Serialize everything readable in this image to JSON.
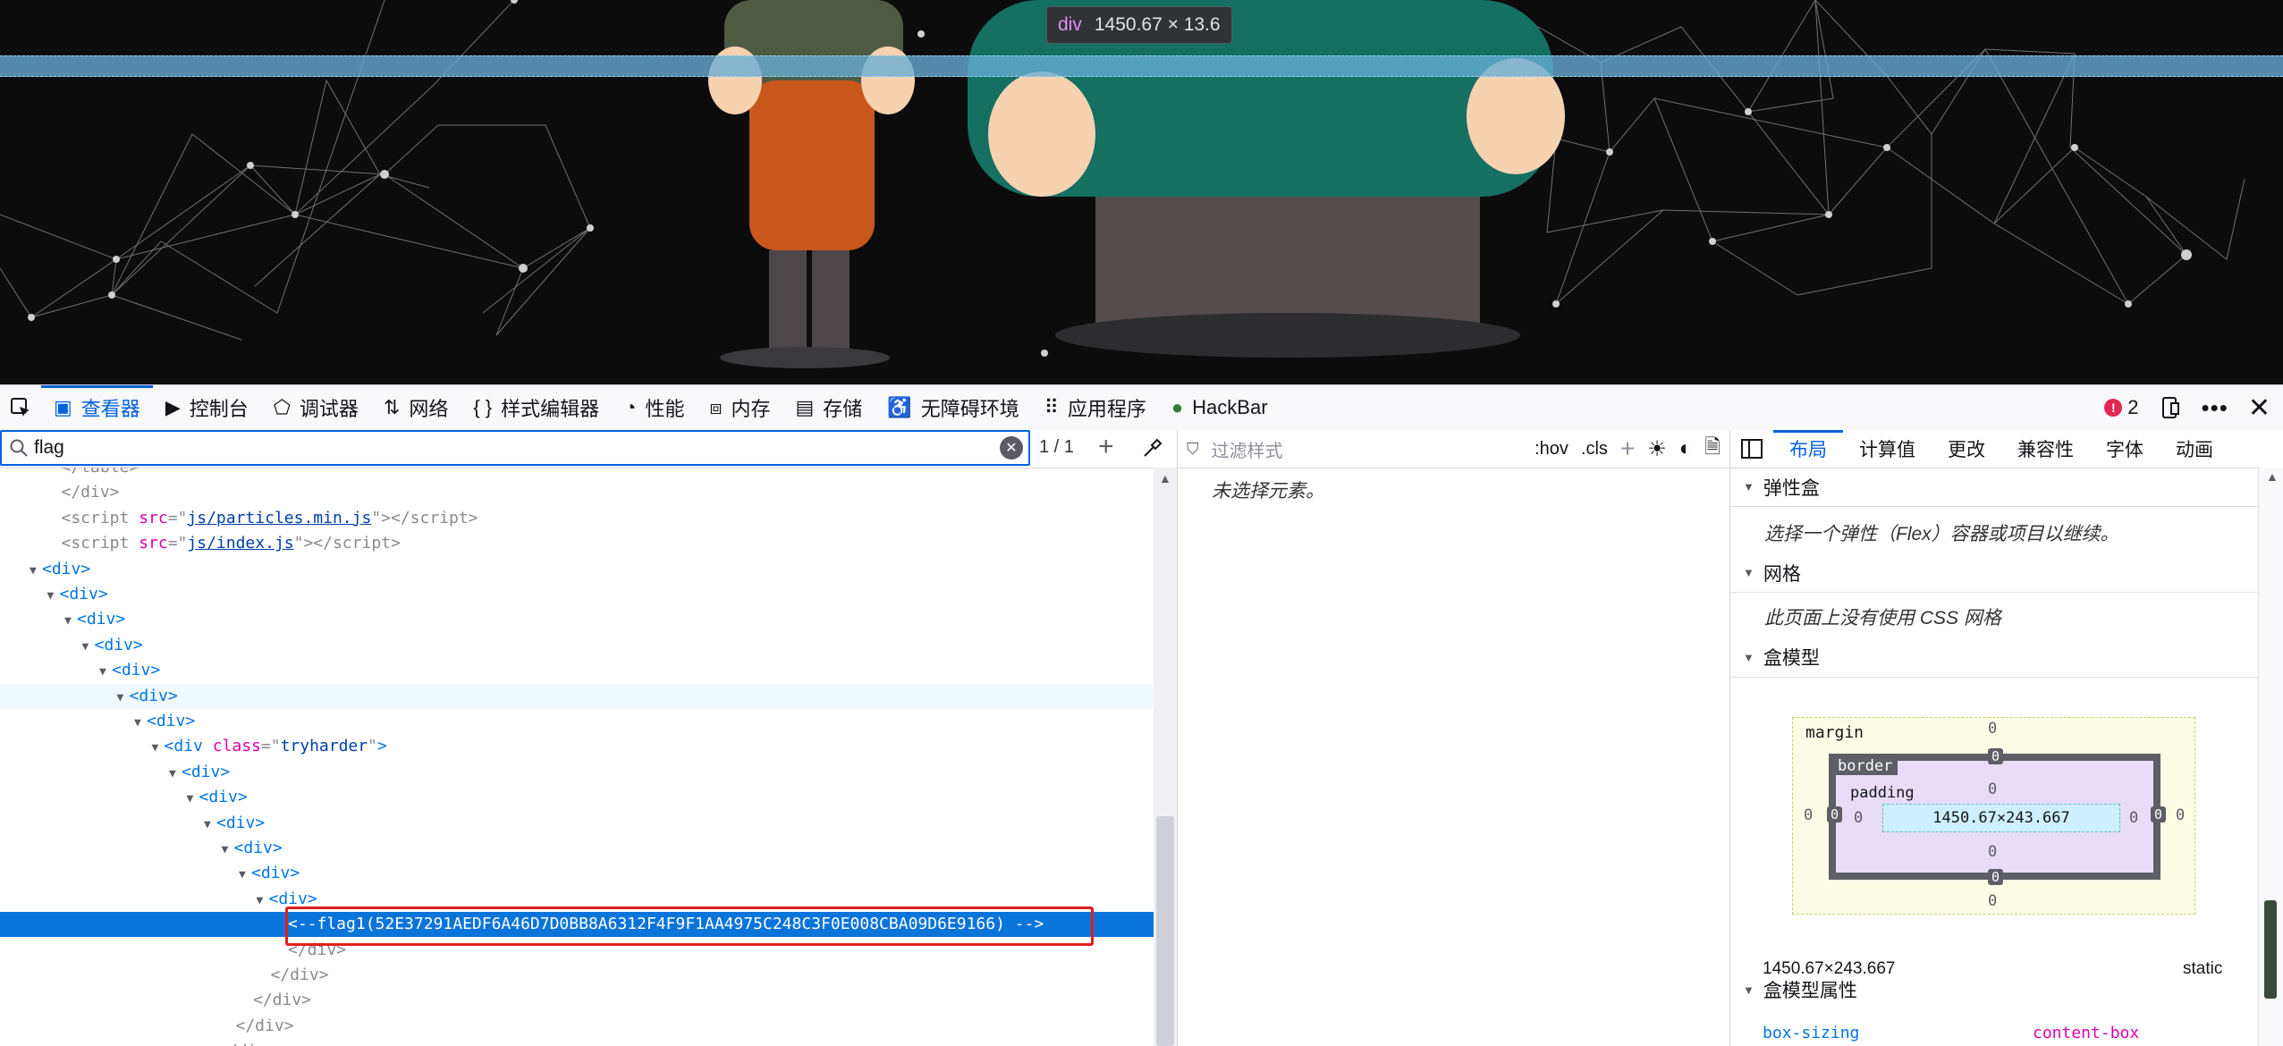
{
  "viewport": {
    "highlight_tag": "div",
    "highlight_dimensions": "1450.67 × 13.6"
  },
  "toolbar": {
    "tabs": [
      {
        "label": "查看器",
        "icon": "inspector-icon"
      },
      {
        "label": "控制台",
        "icon": "console-icon"
      },
      {
        "label": "调试器",
        "icon": "debugger-icon"
      },
      {
        "label": "网络",
        "icon": "network-icon"
      },
      {
        "label": "样式编辑器",
        "icon": "style-editor-icon"
      },
      {
        "label": "性能",
        "icon": "performance-icon"
      },
      {
        "label": "内存",
        "icon": "memory-icon"
      },
      {
        "label": "存储",
        "icon": "storage-icon"
      },
      {
        "label": "无障碍环境",
        "icon": "accessibility-icon"
      },
      {
        "label": "应用程序",
        "icon": "application-icon"
      },
      {
        "label": "HackBar",
        "icon": "hackbar-icon"
      }
    ],
    "error_count": "2",
    "accent": "#0061e0"
  },
  "inspector": {
    "search_value": "flag",
    "search_count": "1 / 1",
    "lines": [
      {
        "indent": 3,
        "text": "</table>",
        "kind": "close"
      },
      {
        "indent": 3,
        "text": "</div>",
        "kind": "close"
      },
      {
        "indent": 3,
        "kind": "script",
        "src": "js/particles.min.js"
      },
      {
        "indent": 3,
        "kind": "script",
        "src": "js/index.js"
      },
      {
        "indent": 2,
        "text": "<div>",
        "kind": "open",
        "twisty": true
      },
      {
        "indent": 3,
        "text": "<div>",
        "kind": "open",
        "twisty": true
      },
      {
        "indent": 4,
        "text": "<div>",
        "kind": "open",
        "twisty": true
      },
      {
        "indent": 5,
        "text": "<div>",
        "kind": "open",
        "twisty": true
      },
      {
        "indent": 6,
        "text": "<div>",
        "kind": "open",
        "twisty": true
      },
      {
        "indent": 7,
        "text": "<div>",
        "kind": "open",
        "twisty": true,
        "hover": true
      },
      {
        "indent": 8,
        "text": "<div>",
        "kind": "open",
        "twisty": true
      },
      {
        "indent": 9,
        "kind": "classdiv",
        "cls": "tryharder",
        "twisty": true
      },
      {
        "indent": 10,
        "text": "<div>",
        "kind": "open",
        "twisty": true
      },
      {
        "indent": 11,
        "text": "<div>",
        "kind": "open",
        "twisty": true
      },
      {
        "indent": 12,
        "text": "<div>",
        "kind": "open",
        "twisty": true
      },
      {
        "indent": 13,
        "text": "<div>",
        "kind": "open",
        "twisty": true
      },
      {
        "indent": 14,
        "text": "<div>",
        "kind": "open",
        "twisty": true
      },
      {
        "indent": 15,
        "text": "<div>",
        "kind": "open",
        "twisty": true
      },
      {
        "indent": 16,
        "text": "<--flag1(52E37291AEDF6A46D7D0BB8A6312F4F9F1AA4975C248C3F0E008CBA09D6E9166) -->",
        "kind": "comment",
        "selected": true
      },
      {
        "indent": 16,
        "text": "</div>",
        "kind": "close"
      },
      {
        "indent": 15,
        "text": "</div>",
        "kind": "close"
      },
      {
        "indent": 14,
        "text": "</div>",
        "kind": "close"
      },
      {
        "indent": 13,
        "text": "</div>",
        "kind": "close"
      },
      {
        "indent": 12,
        "text": "</div>",
        "kind": "close"
      }
    ]
  },
  "rules": {
    "filter_placeholder": "过滤样式",
    "hov_label": ":hov",
    "cls_label": ".cls",
    "empty_text": "未选择元素。"
  },
  "layout": {
    "tabs": [
      "布局",
      "计算值",
      "更改",
      "兼容性",
      "字体",
      "动画"
    ],
    "flex_title": "弹性盒",
    "flex_text": "选择一个弹性（Flex）容器或项目以继续。",
    "grid_title": "网格",
    "grid_text": "此页面上没有使用 CSS 网格",
    "boxmodel_title": "盒模型",
    "boxmodel": {
      "margin_label": "margin",
      "border_label": "border",
      "padding_label": "padding",
      "content": "1450.67×243.667",
      "zero": "0"
    },
    "size_text": "1450.67×243.667",
    "position_text": "static",
    "props_title": "盒模型属性",
    "prop_name": "box-sizing",
    "prop_value": "content-box"
  }
}
